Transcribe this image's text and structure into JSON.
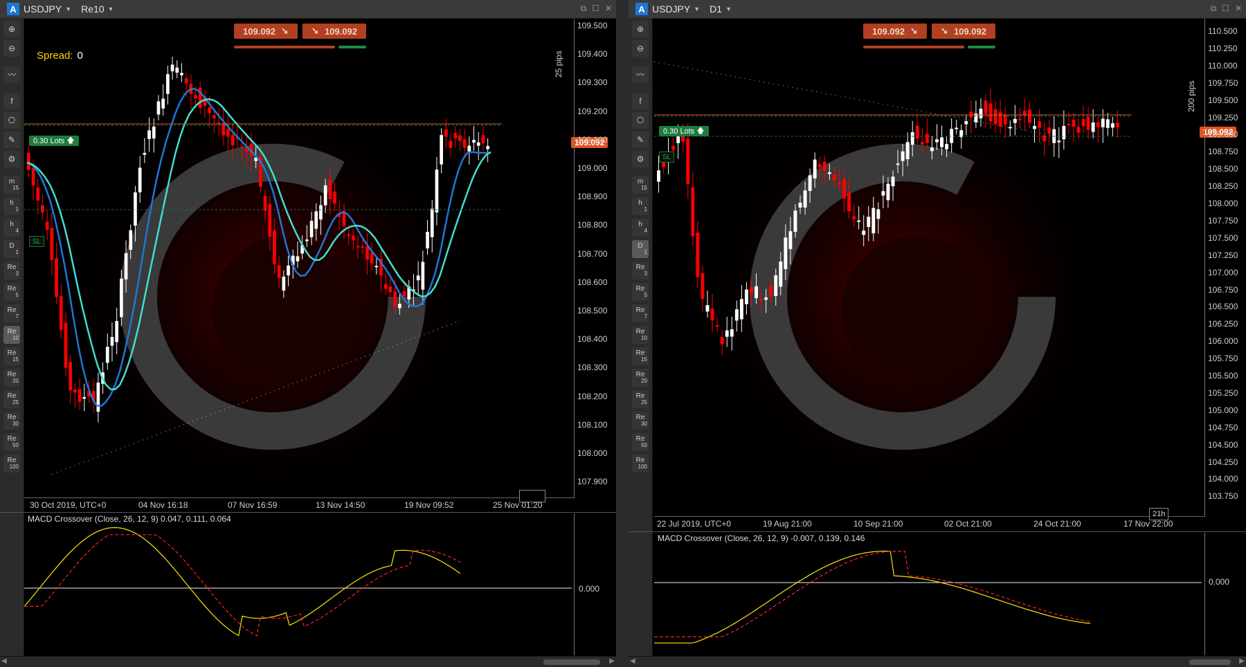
{
  "left": {
    "symbol": "USDJPY",
    "timeframe": "Re10",
    "bid": "109.092",
    "ask": "109.092",
    "spread_label": "Spread:",
    "spread_value": "0",
    "current_price": "109.092",
    "lots": "0.30 Lots",
    "sl": "SL",
    "pips": "25 pips",
    "yticks": [
      "109.500",
      "109.400",
      "109.300",
      "109.200",
      "109.100",
      "109.000",
      "108.900",
      "108.800",
      "108.700",
      "108.600",
      "108.500",
      "108.400",
      "108.300",
      "108.200",
      "108.100",
      "108.000",
      "107.900"
    ],
    "xticks": [
      "30 Oct 2019, UTC+0",
      "04 Nov 16:18",
      "07 Nov 16:59",
      "13 Nov 14:50",
      "19 Nov 09:52",
      "25 Nov 01:20"
    ],
    "macd_label": "MACD Crossover (Close, 26, 12, 9) 0.047, 0.111, 0.064",
    "macd_zero": "0.000"
  },
  "right": {
    "symbol": "USDJPY",
    "timeframe": "D1",
    "bid": "109.092",
    "ask": "109.092",
    "current_price": "109.092",
    "lots": "0.30 Lots",
    "sl": "SL",
    "pips": "200 pips",
    "timer": "21h",
    "yticks": [
      "110.500",
      "110.250",
      "110.000",
      "109.750",
      "109.500",
      "109.250",
      "109.000",
      "108.750",
      "108.500",
      "108.250",
      "108.000",
      "107.750",
      "107.500",
      "107.250",
      "107.000",
      "106.750",
      "106.500",
      "106.250",
      "106.000",
      "105.750",
      "105.500",
      "105.250",
      "105.000",
      "104.750",
      "104.500",
      "104.250",
      "104.000",
      "103.750"
    ],
    "xticks": [
      "22 Jul 2019, UTC+0",
      "19 Aug 21:00",
      "10 Sep 21:00",
      "02 Oct 21:00",
      "24 Oct 21:00",
      "17 Nov 22:00"
    ],
    "macd_label": "MACD Crossover (Close, 26, 12, 9) -0.007, 0.139, 0.146",
    "macd_zero": "0.000"
  },
  "toolbar": {
    "tools": [
      "zoom-in-icon",
      "zoom-out-icon",
      "indicator-icon",
      "social-icon",
      "robot-icon",
      "drawing-icon",
      "chart-settings-icon"
    ],
    "timeframes": [
      {
        "t": "m",
        "s": "15"
      },
      {
        "t": "h",
        "s": "1"
      },
      {
        "t": "h",
        "s": "4"
      },
      {
        "t": "D",
        "s": "1"
      },
      {
        "t": "Re",
        "s": "3"
      },
      {
        "t": "Re",
        "s": "5"
      },
      {
        "t": "Re",
        "s": "7"
      },
      {
        "t": "Re",
        "s": "10"
      },
      {
        "t": "Re",
        "s": "15"
      },
      {
        "t": "Re",
        "s": "20"
      },
      {
        "t": "Re",
        "s": "25"
      },
      {
        "t": "Re",
        "s": "30"
      },
      {
        "t": "Re",
        "s": "50"
      },
      {
        "t": "Re",
        "s": "100"
      }
    ]
  },
  "colors": {
    "bear": "#ff0000",
    "bull": "#ffffff",
    "ma1": "#1e78d6",
    "ma2": "#40e0d0",
    "macd": "#ffe600",
    "signal": "#ff2020",
    "price": "#e2531f"
  }
}
